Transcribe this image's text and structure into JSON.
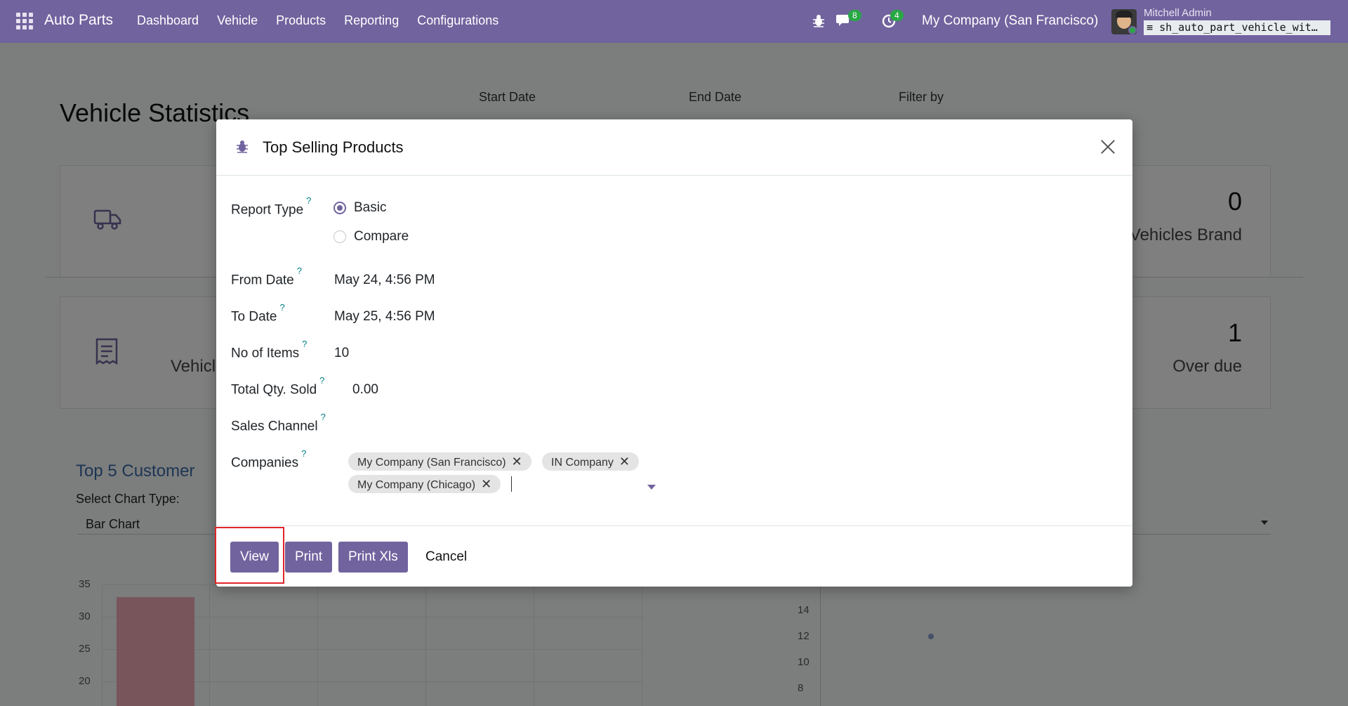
{
  "navbar": {
    "app_name": "Auto Parts",
    "menu": [
      "Dashboard",
      "Vehicle",
      "Products",
      "Reporting",
      "Configurations"
    ],
    "messages_count": "8",
    "activities_count": "4",
    "company": "My Company (San Francisco)",
    "user_name": "Mitchell Admin",
    "database": "sh_auto_part_vehicle_wit…"
  },
  "background": {
    "page_title": "Vehicle Statistics",
    "filters": {
      "start_date": "Start Date",
      "end_date": "End Date",
      "filter_by": "Filter by"
    },
    "cards": [
      {
        "number": "0",
        "label": "Vehicles Brand"
      },
      {
        "number": "1",
        "label": "Over due",
        "left_label": "Vehicl"
      }
    ],
    "section_title": "Top 5 Customer",
    "chart_type_label": "Select Chart Type:",
    "chart_type_value": "Bar Chart"
  },
  "chart_data": [
    {
      "type": "bar",
      "categories": [
        ""
      ],
      "values": [
        33
      ],
      "ylim": [
        20,
        35
      ],
      "yticks": [
        "35",
        "30",
        "25",
        "20"
      ]
    },
    {
      "type": "scatter",
      "yticks": [
        "14",
        "12",
        "10",
        "8"
      ],
      "points": [
        {
          "y": 12
        }
      ]
    }
  ],
  "modal": {
    "title": "Top Selling Products",
    "fields": {
      "report_type": {
        "label": "Report Type",
        "options": [
          "Basic",
          "Compare"
        ],
        "selected": "Basic"
      },
      "from_date": {
        "label": "From Date",
        "value": "May 24, 4:56 PM"
      },
      "to_date": {
        "label": "To Date",
        "value": "May 25, 4:56 PM"
      },
      "no_of_items": {
        "label": "No of Items",
        "value": "10"
      },
      "total_qty_sold": {
        "label": "Total Qty. Sold",
        "value": "0.00"
      },
      "sales_channel": {
        "label": "Sales Channel",
        "value": ""
      },
      "companies": {
        "label": "Companies",
        "tags": [
          "My Company (San Francisco)",
          "IN Company",
          "My Company (Chicago)"
        ]
      }
    },
    "help_mark": "?",
    "buttons": {
      "view": "View",
      "print": "Print",
      "print_xls": "Print Xls",
      "cancel": "Cancel"
    }
  },
  "colors": {
    "brand": "#71639e",
    "highlight": "#e0242b",
    "bar": "#f0aab6"
  }
}
